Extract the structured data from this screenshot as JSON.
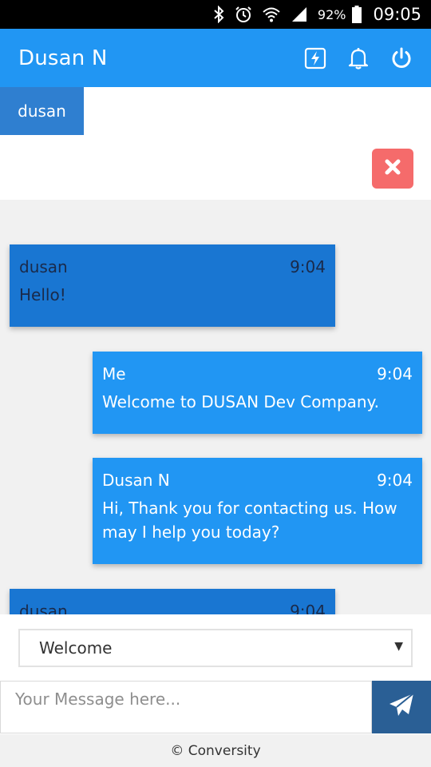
{
  "status_bar": {
    "icons": [
      "bluetooth-icon",
      "alarm-icon",
      "wifi-icon",
      "signal-icon",
      "battery-icon"
    ],
    "battery_percent": "92%",
    "time": "09:05"
  },
  "header": {
    "title": "Dusan N",
    "actions": [
      "flash-icon",
      "bell-icon",
      "power-icon"
    ],
    "background": "#2196f3"
  },
  "tabs": {
    "active_contact": "dusan"
  },
  "messages": [
    {
      "direction": "incoming",
      "sender": "dusan",
      "time": "9:04",
      "text": "Hello!"
    },
    {
      "direction": "outgoing",
      "sender": "Me",
      "time": "9:04",
      "text": "Welcome to DUSAN Dev Company."
    },
    {
      "direction": "outgoing",
      "sender": "Dusan N",
      "time": "9:04",
      "text": "Hi, Thank you for contacting us. How may I help you today?"
    },
    {
      "direction": "incoming",
      "sender": "dusan",
      "time": "9:04",
      "text": ""
    }
  ],
  "composer": {
    "quick_reply_selected": "Welcome",
    "message_placeholder": "Your Message here..."
  },
  "footer": {
    "text": "© Conversity"
  },
  "colors": {
    "incoming_bubble": "#1976d2",
    "outgoing_bubble": "#2196f3",
    "close_button": "#f56b6b",
    "send_button": "#2a5f95"
  }
}
